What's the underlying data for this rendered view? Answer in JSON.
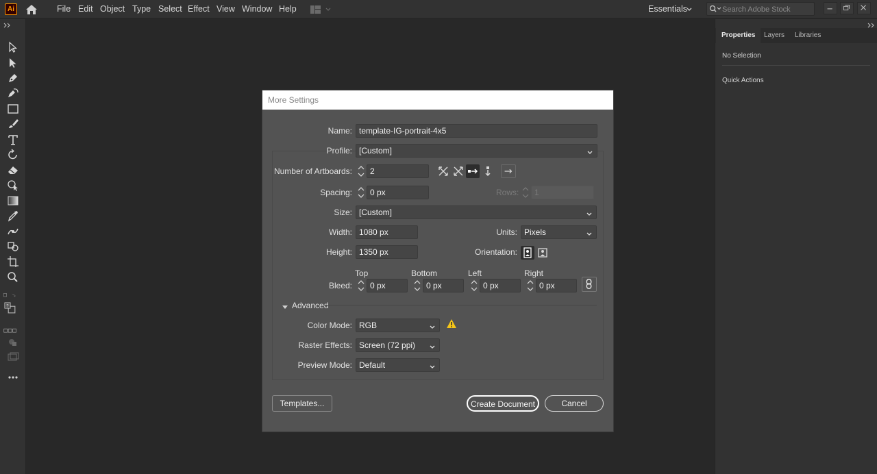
{
  "app": {
    "logo": "Ai"
  },
  "menu": [
    "File",
    "Edit",
    "Object",
    "Type",
    "Select",
    "Effect",
    "View",
    "Window",
    "Help"
  ],
  "workspace": {
    "label": "Essentials"
  },
  "search": {
    "placeholder": "Search Adobe Stock"
  },
  "panel": {
    "tabs": [
      "Properties",
      "Layers",
      "Libraries"
    ],
    "selection": "No Selection",
    "quick_actions": "Quick Actions"
  },
  "dialog": {
    "title": "More Settings",
    "name_label": "Name:",
    "name_value": "template-IG-portrait-4x5",
    "profile_label": "Profile:",
    "profile_value": "[Custom]",
    "artboards_label": "Number of Artboards:",
    "artboards_value": "2",
    "spacing_label": "Spacing:",
    "spacing_value": "0 px",
    "rows_label": "Rows:",
    "rows_value": "1",
    "size_label": "Size:",
    "size_value": "[Custom]",
    "width_label": "Width:",
    "width_value": "1080 px",
    "units_label": "Units:",
    "units_value": "Pixels",
    "height_label": "Height:",
    "height_value": "1350 px",
    "orientation_label": "Orientation:",
    "bleed_label": "Bleed:",
    "bleed": {
      "top_label": "Top",
      "top_value": "0 px",
      "bottom_label": "Bottom",
      "bottom_value": "0 px",
      "left_label": "Left",
      "left_value": "0 px",
      "right_label": "Right",
      "right_value": "0 px"
    },
    "advanced_label": "Advanced",
    "color_mode_label": "Color Mode:",
    "color_mode_value": "RGB",
    "raster_label": "Raster Effects:",
    "raster_value": "Screen (72 ppi)",
    "preview_label": "Preview Mode:",
    "preview_value": "Default",
    "templates_button": "Templates...",
    "create_button": "Create Document",
    "cancel_button": "Cancel"
  },
  "colors": {
    "app_bg": "#282828",
    "chrome": "#323232",
    "dialog_bg": "#535353",
    "warning": "#f5c518",
    "logo_orange": "#ff9a00"
  }
}
